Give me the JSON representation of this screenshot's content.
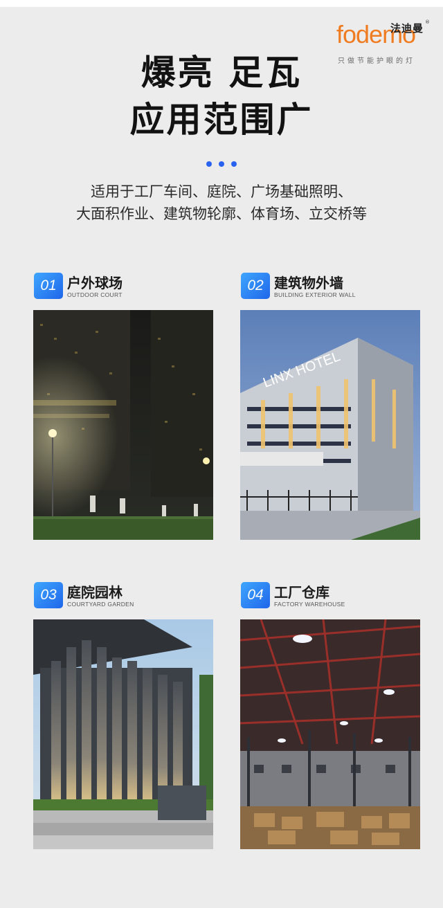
{
  "brand": {
    "logo_word": "fodemo",
    "logo_cn": "法迪曼",
    "logo_reg": "®",
    "slogan": "只做节能护眼的灯"
  },
  "headline": {
    "line1": "爆亮 足瓦",
    "line2": "应用范围广"
  },
  "description": {
    "line1": "适用于工厂车间、庭院、广场基础照明、",
    "line2": "大面积作业、建筑物轮廓、体育场、立交桥等"
  },
  "accent_color": "#2a62f0",
  "scenes": [
    {
      "num": "01",
      "title": "户外球场",
      "subtitle": "OUTDOOR COURT"
    },
    {
      "num": "02",
      "title": "建筑物外墙",
      "subtitle": "BUILDING EXTERIOR WALL",
      "sign": "LINX HOTEL"
    },
    {
      "num": "03",
      "title": "庭院园林",
      "subtitle": "COURTYARD GARDEN"
    },
    {
      "num": "04",
      "title": "工厂仓库",
      "subtitle": "FACTORY WAREHOUSE"
    }
  ]
}
